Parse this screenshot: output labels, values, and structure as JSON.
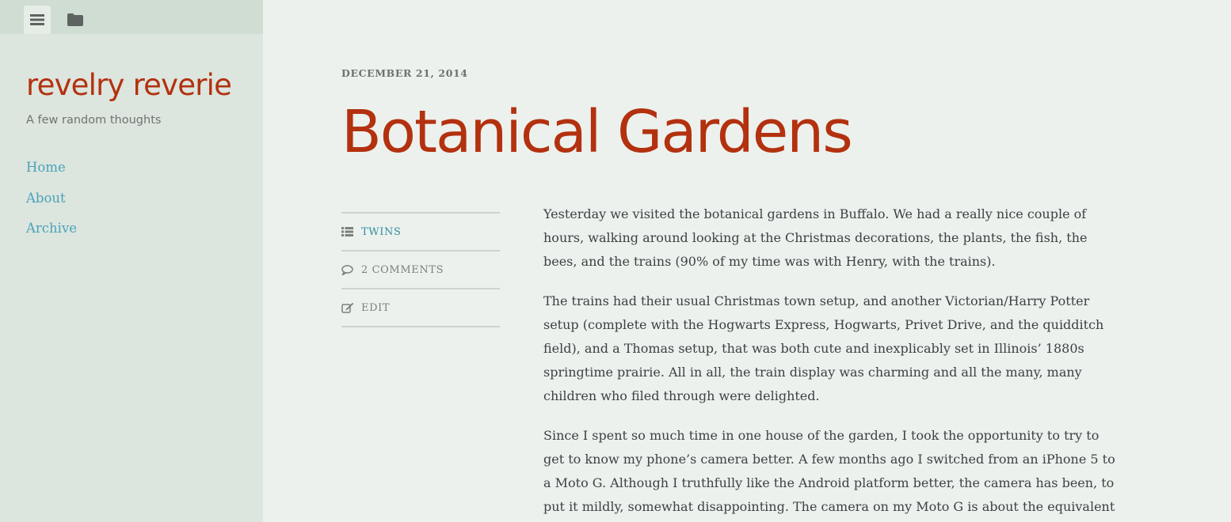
{
  "toolbar": {
    "menu_icon": "menu-icon",
    "folder_icon": "folder-icon"
  },
  "site": {
    "title": "revelry reverie",
    "description": "A few random thoughts"
  },
  "nav": {
    "items": [
      {
        "label": "Home"
      },
      {
        "label": "About"
      },
      {
        "label": "Archive"
      }
    ]
  },
  "post": {
    "date": "December 21, 2014",
    "title": "Botanical Gardens",
    "meta": {
      "category": "Twins",
      "comments": "2 Comments",
      "edit": "Edit"
    },
    "paragraphs": [
      "Yesterday we visited the botanical gardens in Buffalo. We had a really nice couple of hours, walking around looking at the Christmas decorations, the plants, the fish, the bees, and the trains (90% of my time was with Henry, with the trains).",
      "The trains had their usual Christmas town setup, and another Victorian/Harry Potter setup (complete with the Hogwarts Express, Hogwarts, Privet Drive, and the quidditch field), and a Thomas setup, that was both cute and inexplicably set in Illinois’ 1880s springtime prairie. All in all, the train display was charming and all the many, many children who filed through were delighted.",
      "Since I spent so much time in one house of the garden, I took the opportunity to try to get to know my phone’s camera better. A few months ago I switched from an iPhone 5 to a Moto G. Although I truthfully like the Android platform better, the camera has been, to put it mildly, somewhat disappointing. The camera on my Moto G is about the equivalent"
    ]
  },
  "colors": {
    "accent": "#b3310f",
    "link": "#4aa3b8",
    "sidebar_bg": "#dce5de",
    "page_bg": "#ecf1ed"
  }
}
